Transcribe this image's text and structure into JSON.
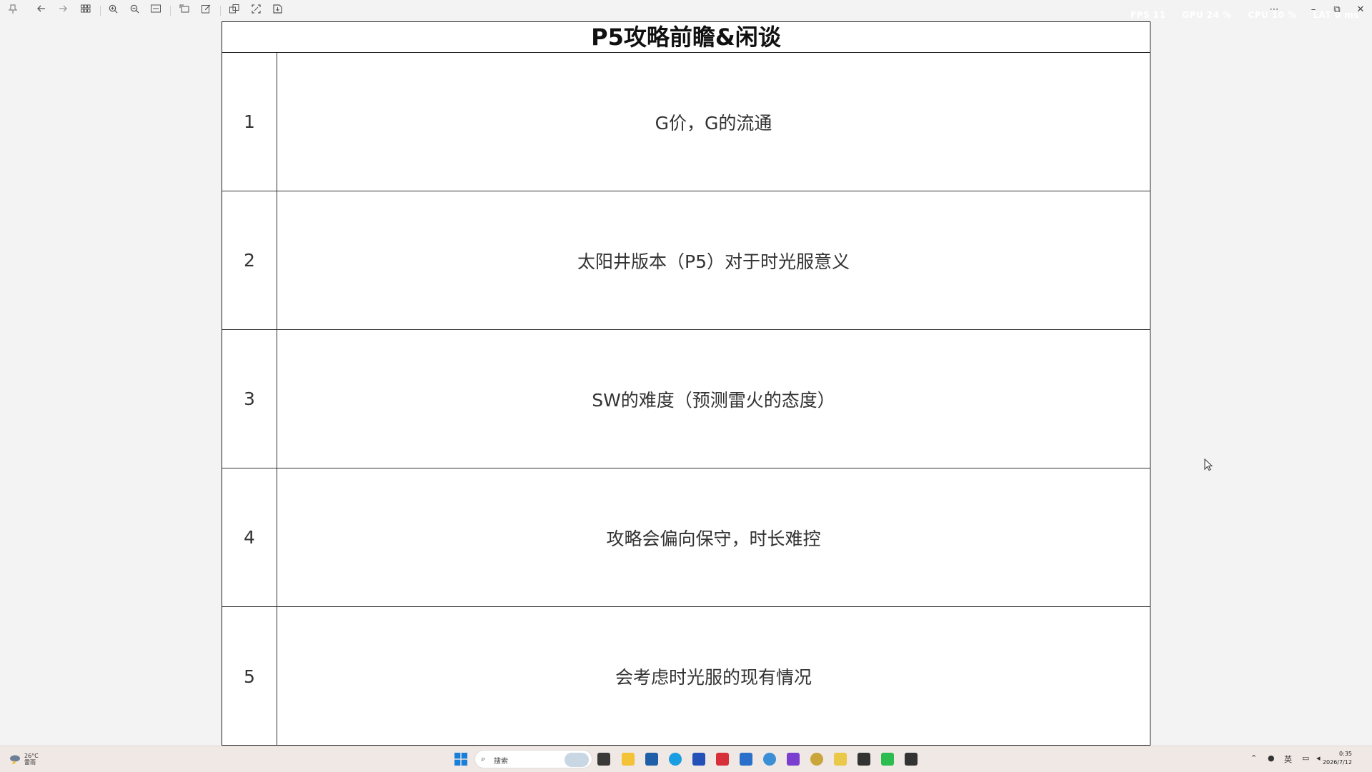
{
  "toolbar": {
    "icons": [
      "pin-icon",
      "back-icon",
      "forward-icon",
      "grid-view-icon",
      "zoom-in-icon",
      "zoom-out-icon",
      "fit-width-icon",
      "rotate-icon",
      "edit-icon",
      "copy-icon",
      "screenshot-icon",
      "save-icon"
    ],
    "stats": {
      "fps": "FPS 11",
      "gpu": "GPU 24 %",
      "cpu": "CPU 10 %",
      "lat": "LAT 0 ms"
    }
  },
  "document": {
    "title": "P5攻略前瞻&闲谈",
    "rows": [
      {
        "num": "1",
        "text": "G价，G的流通"
      },
      {
        "num": "2",
        "text": "太阳井版本（P5）对于时光服意义"
      },
      {
        "num": "3",
        "text": "SW的难度（预测雷火的态度）"
      },
      {
        "num": "4",
        "text": "攻略会偏向保守，时长难控"
      },
      {
        "num": "5",
        "text": "会考虑时光服的现有情况"
      }
    ]
  },
  "taskbar": {
    "weather": {
      "temp": "26°C",
      "desc": "雷雨"
    },
    "search_placeholder": "搜索",
    "tray": {
      "lang": "英"
    },
    "clock": {
      "time": "0:35",
      "date": "2026/7/12"
    }
  },
  "colors": {
    "page_bg": "#ffffff",
    "canvas_bg": "#f3f3f3",
    "taskbar_bg": "#efe8e4",
    "border": "#222222"
  }
}
